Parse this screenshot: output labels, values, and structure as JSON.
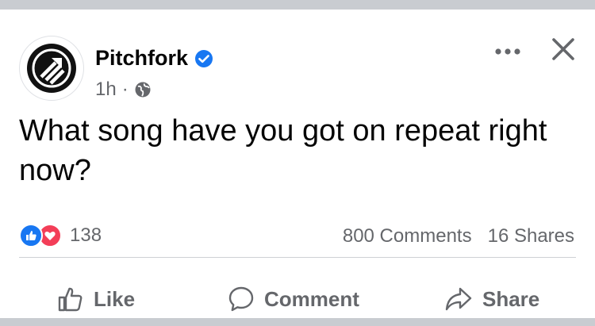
{
  "post": {
    "page_name": "Pitchfork",
    "verified": true,
    "time": "1h",
    "separator": "·",
    "privacy_icon": "globe-icon",
    "text": "What song have you got on repeat right now?"
  },
  "header_actions": {
    "more_icon": "more-dots-icon",
    "close_icon": "close-icon"
  },
  "engagement": {
    "reaction_icons": [
      "like-reaction-icon",
      "love-reaction-icon"
    ],
    "reaction_count": "138",
    "comments": "800 Comments",
    "shares": "16 Shares"
  },
  "actions": {
    "like": "Like",
    "comment": "Comment",
    "share": "Share"
  },
  "colors": {
    "verified_blue": "#1877f2",
    "like_blue": "#1877f2",
    "love_red": "#f33e58",
    "secondary_text": "#65676b",
    "primary_text": "#050505"
  }
}
